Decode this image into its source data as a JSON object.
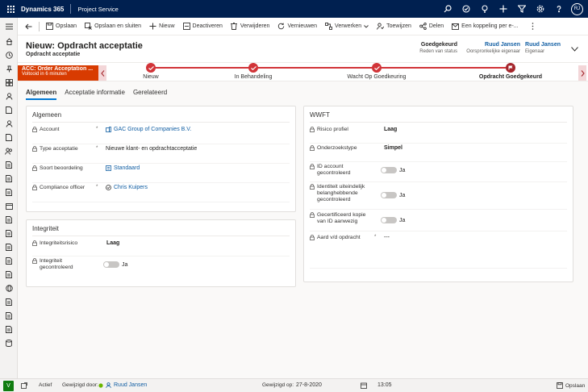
{
  "app": {
    "name": "Dynamics 365",
    "area": "Project Service",
    "user_initials": "RJ"
  },
  "commands": [
    "Opslaan",
    "Opslaan en sluiten",
    "Nieuw",
    "Deactiveren",
    "Verwijderen",
    "Vernieuwen",
    "Verwerken",
    "Toewijzen",
    "Delen",
    "Een koppeling per e-..."
  ],
  "header": {
    "title": "Nieuw: Opdracht acceptatie",
    "subtitle": "Opdracht acceptatie",
    "status_value": "Goedgekeurd",
    "status_label": "Reden van status",
    "orig_owner_value": "Ruud Jansen",
    "orig_owner_label": "Oorspronkelijke eigenaar",
    "owner_value": "Ruud Jansen",
    "owner_label": "Eigenaar"
  },
  "bpf": {
    "flag_title": "ACC: Order Acceptation ...",
    "flag_sub": "Voltooid in 6 minuten",
    "stages": [
      "Nieuw",
      "In Behandeling",
      "Wacht Op Goedkeuring",
      "Opdracht Goedgekeurd"
    ]
  },
  "tabs": [
    "Algemeen",
    "Acceptatie informatie",
    "Gerelateerd"
  ],
  "algemeen": {
    "title": "Algemeen",
    "rows": [
      {
        "label": "Account",
        "value": "GAC Group of Companies B.V."
      },
      {
        "label": "Type acceptatie",
        "value": "Nieuwe klant- en opdrachtacceptatie"
      },
      {
        "label": "Soort beoordeling",
        "value": "Standaard"
      },
      {
        "label": "Compliance officer",
        "value": "Chris Kuipers"
      }
    ]
  },
  "integriteit": {
    "title": "Integriteit",
    "risico_label": "Integriteitsrisico",
    "risico_value": "Laag",
    "gecontroleerd_label_1": "Integriteit",
    "gecontroleerd_label_2": "gecontroleerd",
    "gecontroleerd_value": "Ja"
  },
  "wwft": {
    "title": "WWFT",
    "risico_label": "Risico profiel",
    "risico_value": "Laag",
    "onderzoek_label": "Onderzoekstype",
    "onderzoek_value": "Simpel",
    "id_label_1": "ID account",
    "id_label_2": "gecontroleerd",
    "id_value": "Ja",
    "ident_label_1": "Identiteit uiteindelijk",
    "ident_label_2": "belanghebbende",
    "ident_label_3": "gecontroleerd",
    "ident_value": "Ja",
    "kopie_label_1": "Gecertificeerd kopie",
    "kopie_label_2": "van ID aanwezig",
    "kopie_value": "Ja",
    "aard_label": "Aard v/d opdracht",
    "aard_value": "---"
  },
  "footer": {
    "badge": "V",
    "status": "Actief",
    "modified_by_label": "Gewijzigd door:",
    "modified_by": "Ruud Jansen",
    "modified_on_label": "Gewijzigd op:",
    "date": "27-8-2020",
    "time": "13:05",
    "save": "Opslaan"
  },
  "colors": {
    "topbar": "#002050",
    "accent": "#d13438",
    "flag": "#d83b01",
    "link": "#115ea3"
  }
}
